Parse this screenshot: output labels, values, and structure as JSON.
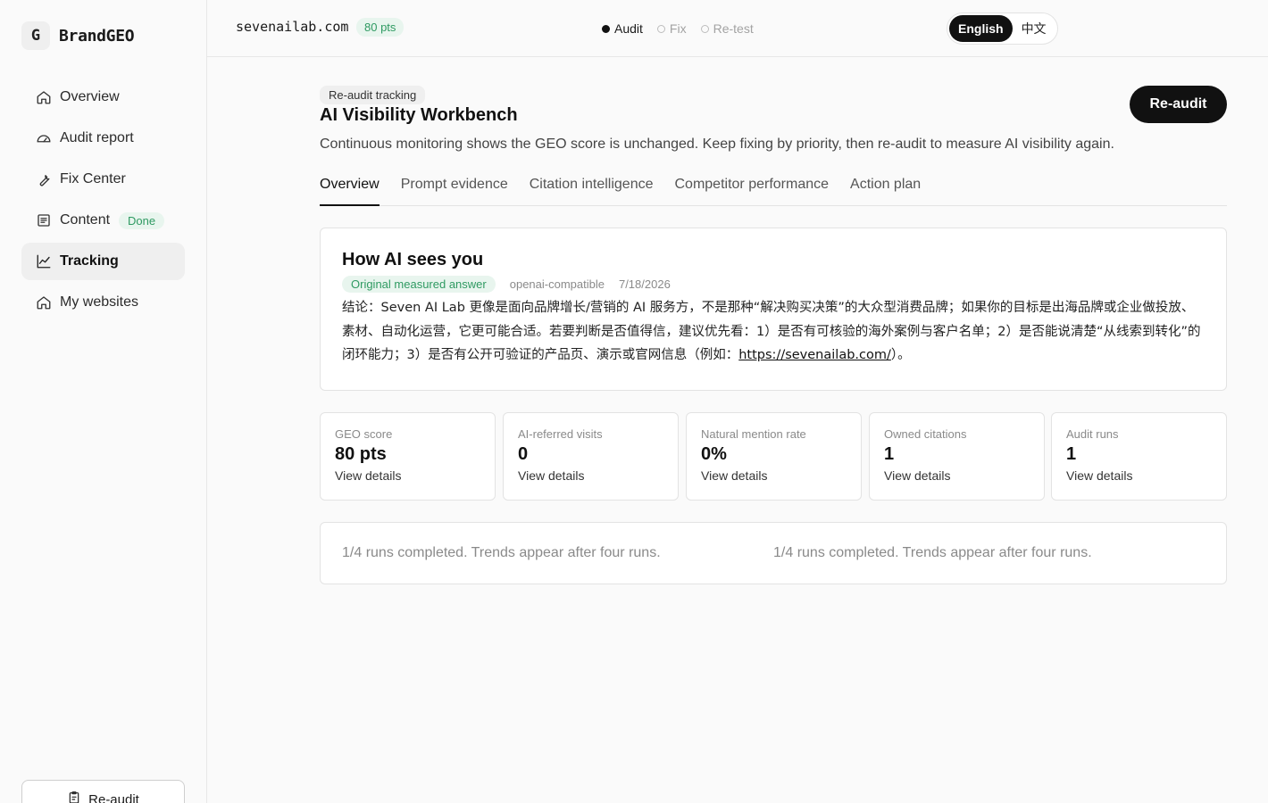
{
  "brand": {
    "mark": "G",
    "name": "BrandGEO"
  },
  "sidebar": {
    "items": [
      {
        "label": "Overview",
        "icon": "home-icon"
      },
      {
        "label": "Audit report",
        "icon": "gauge-icon"
      },
      {
        "label": "Fix Center",
        "icon": "wrench-icon"
      },
      {
        "label": "Content",
        "icon": "document-icon",
        "badge": "Done"
      },
      {
        "label": "Tracking",
        "icon": "chart-line-icon",
        "active": true
      },
      {
        "label": "My websites",
        "icon": "home-icon"
      }
    ],
    "reaudit_label": "Re-audit"
  },
  "topbar": {
    "domain": "sevenailab.com",
    "score_badge": "80 pts",
    "steps": [
      "Audit",
      "Fix",
      "Re-test"
    ],
    "lang": {
      "en": "English",
      "zh": "中文"
    }
  },
  "header": {
    "tag": "Re-audit tracking",
    "title": "AI Visibility Workbench",
    "subtitle": "Continuous monitoring shows the GEO score is unchanged. Keep fixing by priority, then re-audit to measure AI visibility again.",
    "reaudit_button": "Re-audit"
  },
  "tabs": [
    "Overview",
    "Prompt evidence",
    "Citation intelligence",
    "Competitor performance",
    "Action plan"
  ],
  "ai_card": {
    "title": "How AI sees you",
    "answer_badge": "Original measured answer",
    "provider": "openai-compatible",
    "date": "7/18/2026",
    "answer_prefix": "结论：Seven AI Lab 更像是面向品牌增长/营销的 AI 服务方，不是那种“解决购买决策”的大众型消费品牌；如果你的目标是出海品牌或企业做投放、素材、自动化运营，它更可能合适。若要判断是否值得信，建议优先看：1）是否有可核验的海外案例与客户名单；2）是否能说清楚“从线索到转化”的闭环能力；3）是否有公开可验证的产品页、演示或官网信息（例如：",
    "answer_link": "https://sevenailab.com/",
    "answer_suffix": "）。"
  },
  "stats": [
    {
      "label": "GEO score",
      "value": "80 pts",
      "link": "View details"
    },
    {
      "label": "AI-referred visits",
      "value": "0",
      "link": "View details"
    },
    {
      "label": "Natural mention rate",
      "value": "0%",
      "link": "View details"
    },
    {
      "label": "Owned citations",
      "value": "1",
      "link": "View details"
    },
    {
      "label": "Audit runs",
      "value": "1",
      "link": "View details"
    }
  ],
  "trends": {
    "left": "1/4 runs completed. Trends appear after four runs.",
    "right": "1/4 runs completed. Trends appear after four runs."
  }
}
